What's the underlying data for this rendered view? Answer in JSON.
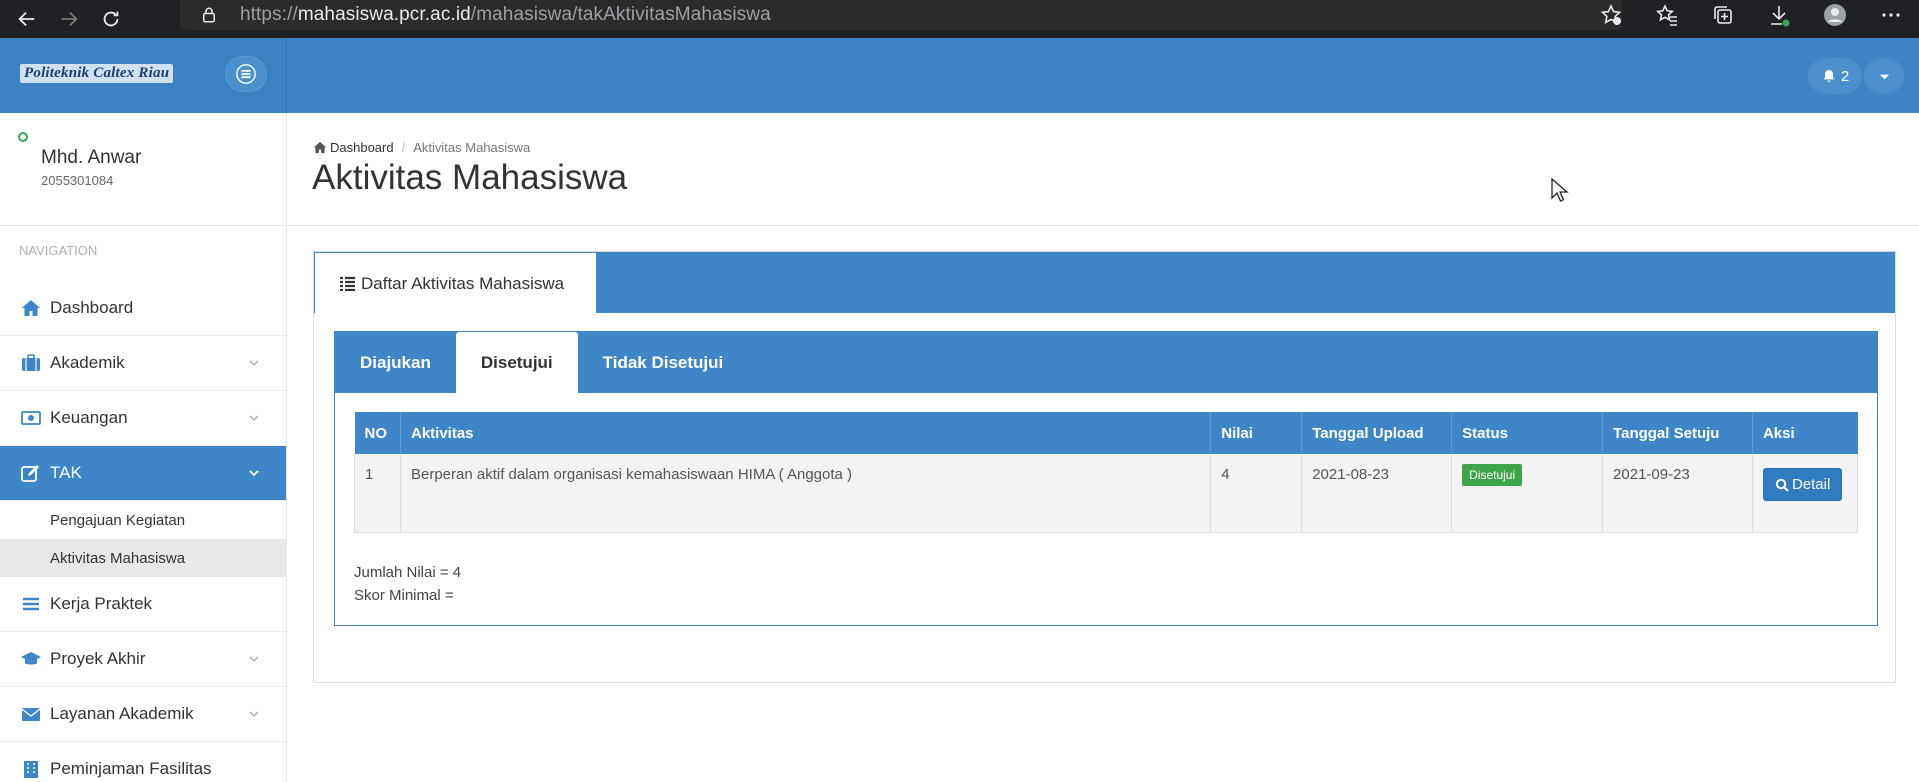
{
  "browser": {
    "url_scheme": "https://",
    "url_host": "mahasiswa.pcr.ac.id",
    "url_path": "/mahasiswa/takAktivitasMahasiswa"
  },
  "header": {
    "brand": "Politeknik Caltex Riau",
    "notification_count": "2"
  },
  "sidebar": {
    "user_name": "Mhd. Anwar",
    "user_id": "2055301084",
    "nav_header": "NAVIGATION",
    "items": [
      {
        "label": "Dashboard",
        "icon": "home-icon"
      },
      {
        "label": "Akademik",
        "icon": "briefcase-icon"
      },
      {
        "label": "Keuangan",
        "icon": "money-icon"
      },
      {
        "label": "TAK",
        "icon": "edit-icon"
      },
      {
        "label": "Kerja Praktek",
        "icon": "bars-icon"
      },
      {
        "label": "Proyek Akhir",
        "icon": "graduation-cap-icon"
      },
      {
        "label": "Layanan Akademik",
        "icon": "envelope-icon"
      },
      {
        "label": "Peminjaman Fasilitas",
        "icon": "building-icon"
      }
    ],
    "tak_subitems": [
      "Pengajuan Kegiatan",
      "Aktivitas Mahasiswa"
    ]
  },
  "breadcrumb": {
    "home": "Dashboard",
    "current": "Aktivitas Mahasiswa"
  },
  "page_title": "Aktivitas Mahasiswa",
  "box": {
    "tab_label": "Daftar Aktivitas Mahasiswa"
  },
  "inner_tabs": [
    "Diajukan",
    "Disetujui",
    "Tidak Disetujui"
  ],
  "table": {
    "columns": [
      "NO",
      "Aktivitas",
      "Nilai",
      "Tanggal Upload",
      "Status",
      "Tanggal Setuju",
      "Aksi"
    ],
    "rows": [
      {
        "no": "1",
        "aktivitas": "Berperan aktif dalam organisasi kemahasiswaan HIMA ( Anggota )",
        "nilai": "4",
        "tanggal_upload": "2021-08-23",
        "status": "Disetujui",
        "tanggal_setuju": "2021-09-23",
        "aksi": "Detail"
      }
    ]
  },
  "summary": {
    "jumlah_nilai": "Jumlah Nilai = 4",
    "skor_minimal": "Skor Minimal ="
  },
  "colors": {
    "primary": "#3e86c8",
    "success": "#3ea54a",
    "online": "#3aa55d"
  }
}
